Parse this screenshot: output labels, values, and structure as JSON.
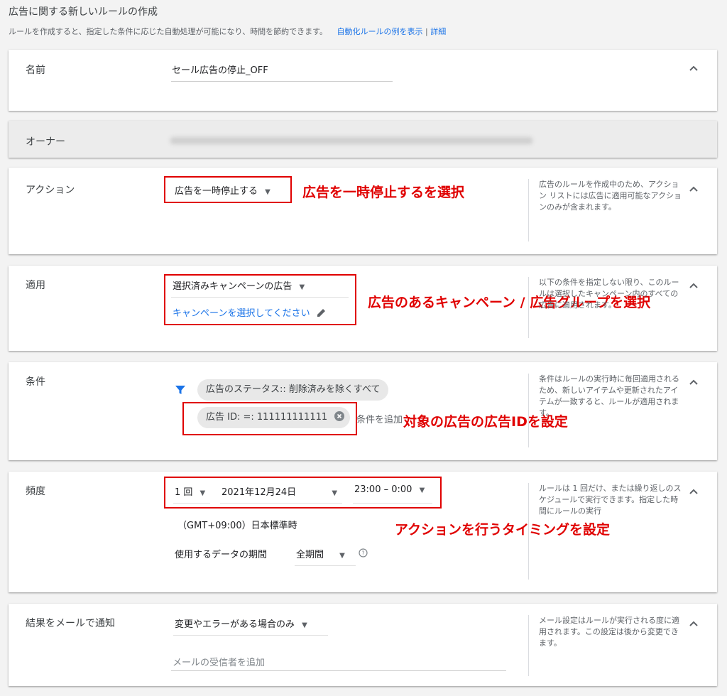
{
  "header": {
    "title": "広告に関する新しいルールの作成",
    "subtitle": "ルールを作成すると、指定した条件に応じた自動処理が可能になり、時間を節約できます。",
    "link_examples": "自動化ルールの例を表示",
    "separator": "|",
    "link_details": "詳細"
  },
  "name_section": {
    "label": "名前",
    "value": "セール広告の停止_OFF"
  },
  "owner_section": {
    "label": "オーナー"
  },
  "action_section": {
    "label": "アクション",
    "dropdown": "広告を一時停止する",
    "help": "広告のルールを作成中のため、アクション リストには広告に適用可能なアクションのみが含まれます。",
    "annotation": "広告を一時停止するを選択"
  },
  "apply_section": {
    "label": "適用",
    "dropdown": "選択済みキャンペーンの広告",
    "link": "キャンペーンを選択してください",
    "help": "以下の条件を指定しない限り、このルールは選択したキャンペーン内のすべての広告に適用されます。",
    "annotation": "広告のあるキャンペーン / 広告グループを選択"
  },
  "condition_section": {
    "label": "条件",
    "chip_status": "広告のステータス:: 削除済みを除くすべて",
    "chip_id": "広告 ID: =: 111111111111",
    "add_condition": "条件を追加",
    "help": "条件はルールの実行時に毎回適用されるため、新しいアイテムや更新されたアイテムが一致すると、ルールが適用されます。",
    "annotation": "対象の広告の広告IDを設定"
  },
  "frequency_section": {
    "label": "頻度",
    "freq_value": "1 回",
    "date_value": "2021年12月24日",
    "time_value": "23:00 – 0:00",
    "timezone": "（GMT+09:00）日本標準時",
    "period_label": "使用するデータの期間",
    "period_value": "全期間",
    "help": "ルールは 1 回だけ、または繰り返しのスケジュールで実行できます。指定した時間にルールの実行",
    "annotation": "アクションを行うタイミングを設定"
  },
  "email_section": {
    "label": "結果をメールで通知",
    "dropdown": "変更やエラーがある場合のみ",
    "recipient_placeholder": "メールの受信者を追加",
    "help": "メール設定はルールが実行される度に適用されます。この設定は後から変更できます。"
  },
  "colors": {
    "accent": "#1a73e8",
    "annotation_red": "#e00000",
    "card_bg": "#ffffff",
    "page_bg": "#f3f3f3"
  },
  "icons": {
    "collapse": "chevron-up-icon",
    "dropdown": "triangle-down-icon",
    "edit": "pencil-icon",
    "filter": "funnel-icon",
    "clear": "close-circle-icon",
    "help": "question-circle-icon"
  }
}
